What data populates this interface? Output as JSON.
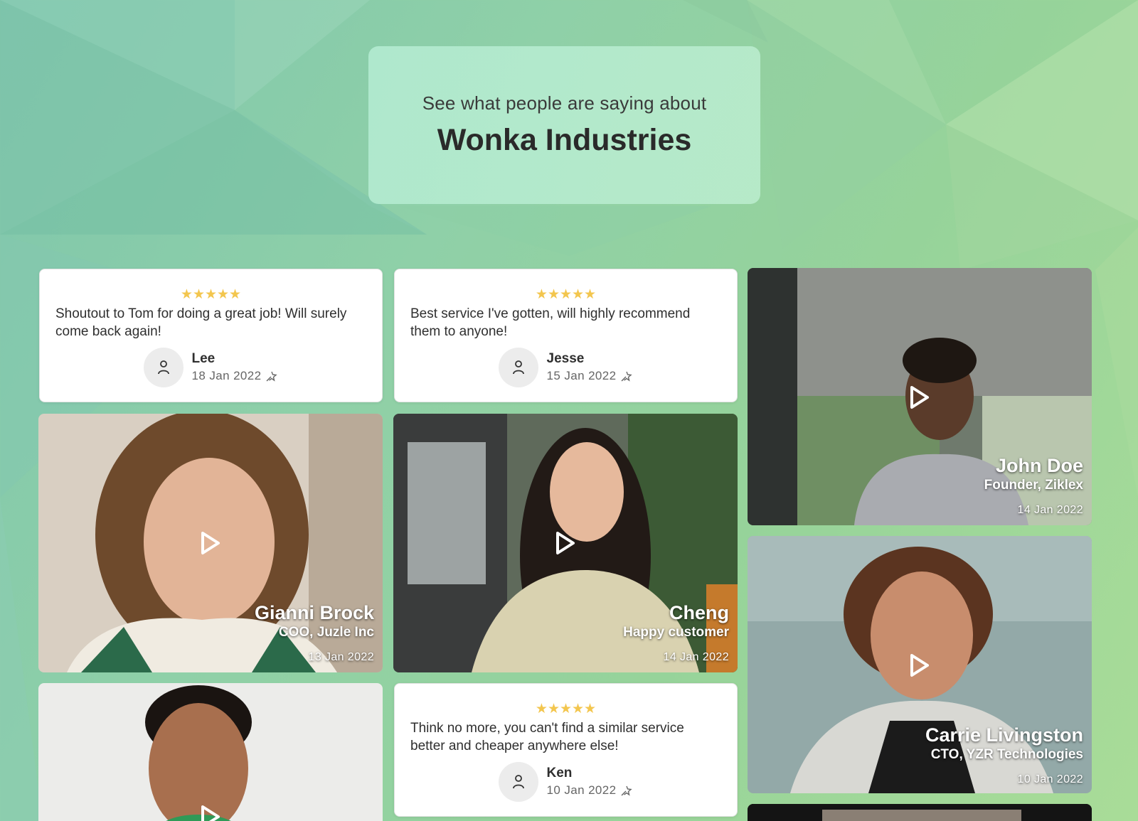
{
  "header": {
    "subtitle": "See what people are saying about",
    "title": "Wonka Industries"
  },
  "colors": {
    "star": "#f3c64e",
    "background_start": "#7fc6ac",
    "background_end": "#a9dc98",
    "header_box": "#b8ecd2"
  },
  "text_reviews": [
    {
      "stars": "★★★★★",
      "text": "Shoutout to Tom for doing a great job! Will surely come back again!",
      "author": "Lee",
      "date": "18 Jan 2022",
      "source_icon": "magic-star-icon",
      "avatar_icon": "user-icon"
    },
    {
      "stars": "★★★★★",
      "text": "Best service I've gotten, will highly recommend them to anyone!",
      "author": "Jesse",
      "date": "15 Jan 2022",
      "source_icon": "magic-star-icon",
      "avatar_icon": "user-icon"
    },
    {
      "stars": "★★★★★",
      "text": "Think no more, you can't find a similar service better and cheaper anywhere else!",
      "author": "Ken",
      "date": "10 Jan 2022",
      "source_icon": "magic-star-icon",
      "avatar_icon": "user-icon"
    }
  ],
  "video_reviews": [
    {
      "name": "John Doe",
      "role": "Founder, Ziklex",
      "date": "14 Jan 2022",
      "icon": "play-icon"
    },
    {
      "name": "Gianni Brock",
      "role": "COO, Juzle Inc",
      "date": "13 Jan 2022",
      "icon": "play-icon"
    },
    {
      "name": "Cheng",
      "role": "Happy customer",
      "date": "14 Jan 2022",
      "icon": "play-icon"
    },
    {
      "name": "Carrie Livingston",
      "role": "CTO, YZR Technologies",
      "date": "10 Jan 2022",
      "icon": "play-icon"
    },
    {
      "name": "",
      "role": "",
      "date": "",
      "icon": "play-icon"
    },
    {
      "name": "",
      "role": "",
      "date": "",
      "icon": ""
    }
  ]
}
